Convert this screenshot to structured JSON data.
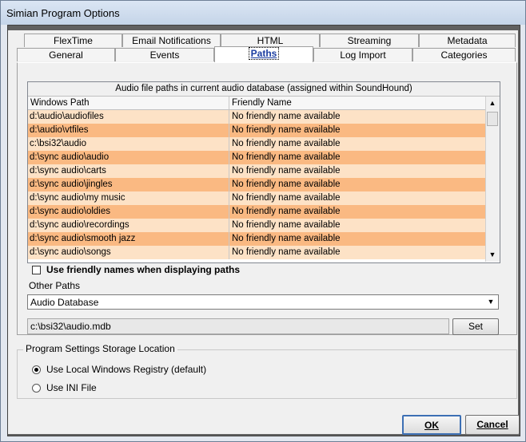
{
  "window": {
    "title": "Simian Program Options"
  },
  "tabs_row1": [
    "FlexTime",
    "Email Notifications",
    "HTML",
    "Streaming",
    "Metadata"
  ],
  "tabs_row2": [
    "General",
    "Events",
    "Paths",
    "Log Import",
    "Categories"
  ],
  "active_tab": "Paths",
  "grid": {
    "caption": "Audio file paths in current audio database (assigned within SoundHound)",
    "col_path": "Windows Path",
    "col_name": "Friendly Name",
    "rows": [
      {
        "path": "d:\\audio\\audiofiles",
        "name": "No friendly name available"
      },
      {
        "path": "d:\\audio\\vtfiles",
        "name": "No friendly name available"
      },
      {
        "path": "c:\\bsi32\\audio",
        "name": "No friendly name available"
      },
      {
        "path": "d:\\sync audio\\audio",
        "name": "No friendly name available"
      },
      {
        "path": "d:\\sync audio\\carts",
        "name": "No friendly name available"
      },
      {
        "path": "d:\\sync audio\\jingles",
        "name": "No friendly name available"
      },
      {
        "path": "d:\\sync audio\\my music",
        "name": "No friendly name available"
      },
      {
        "path": "d:\\sync audio\\oldies",
        "name": "No friendly name available"
      },
      {
        "path": "d:\\sync audio\\recordings",
        "name": "No friendly name available"
      },
      {
        "path": "d:\\sync audio\\smooth jazz",
        "name": "No friendly name available"
      },
      {
        "path": "d:\\sync audio\\songs",
        "name": "No friendly name available"
      }
    ],
    "row_colors": {
      "light": "#fde2c6",
      "dark": "#fab982"
    }
  },
  "friendly_names_checkbox": {
    "label": "Use friendly names when displaying paths",
    "checked": false
  },
  "other_paths": {
    "label": "Other Paths",
    "selected": "Audio Database",
    "path_value": "c:\\bsi32\\audio.mdb",
    "set_label": "Set"
  },
  "storage": {
    "title": "Program Settings Storage Location",
    "option_registry": "Use Local Windows Registry (default)",
    "option_ini": "Use INI File",
    "selected": "registry"
  },
  "buttons": {
    "ok": "OK",
    "cancel": "Cancel"
  }
}
